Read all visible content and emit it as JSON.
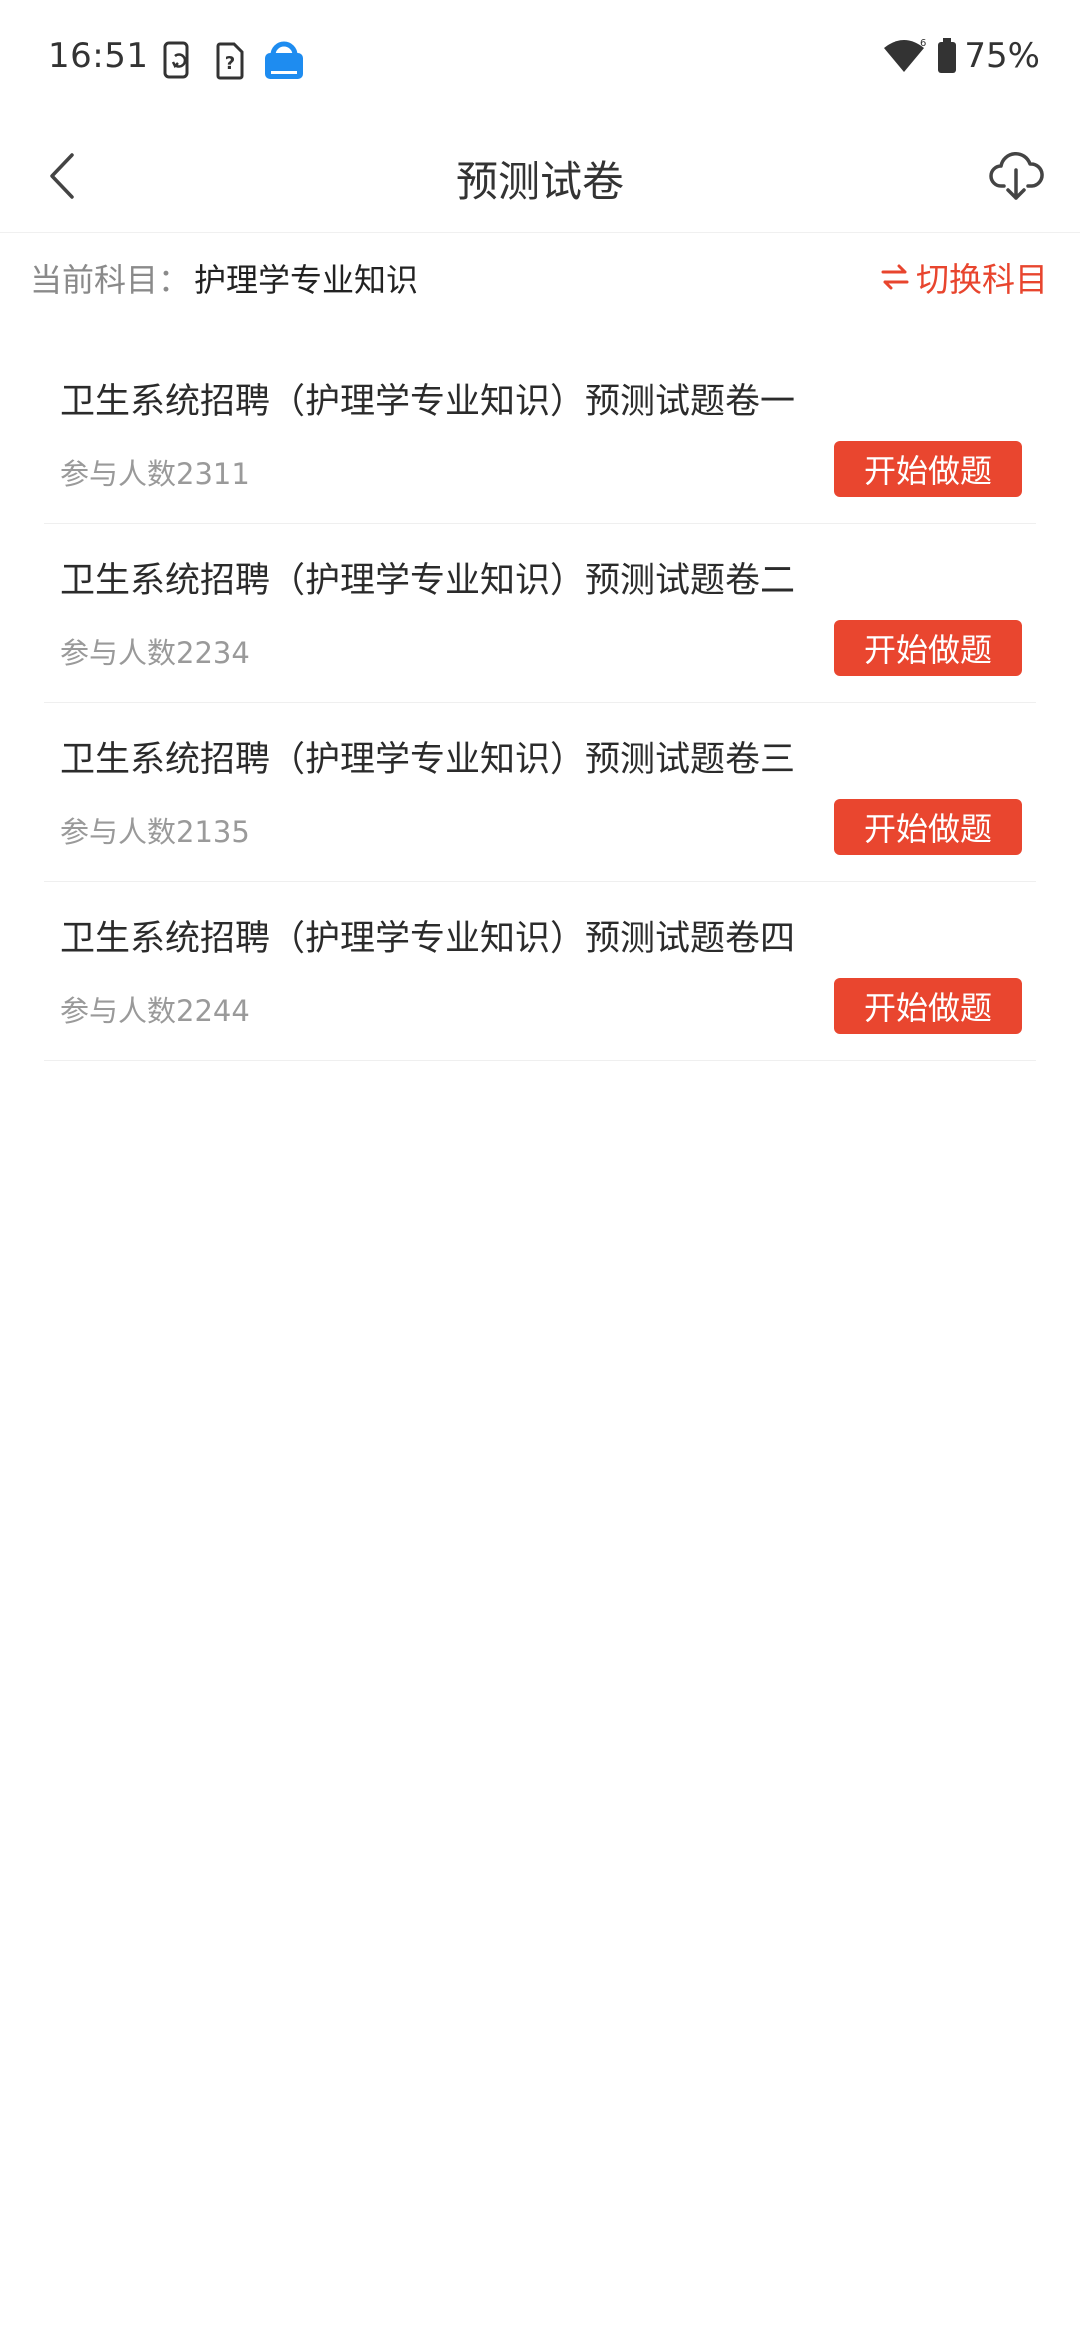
{
  "status_bar": {
    "time": "16:51",
    "icons": [
      "phone-sync-icon",
      "sim-question-icon",
      "app-notification-icon"
    ],
    "battery": "75%"
  },
  "header": {
    "title": "预测试卷",
    "back_icon": "chevron-left-icon",
    "download_icon": "cloud-download-icon"
  },
  "subject": {
    "label": "当前科目：",
    "value": "护理学专业知识",
    "switch_label": "切换科目"
  },
  "papers": [
    {
      "title": "卫生系统招聘（护理学专业知识）预测试题卷一",
      "participants": "参与人数2311",
      "button": "开始做题"
    },
    {
      "title": "卫生系统招聘（护理学专业知识）预测试题卷二",
      "participants": "参与人数2234",
      "button": "开始做题"
    },
    {
      "title": "卫生系统招聘（护理学专业知识）预测试题卷三",
      "participants": "参与人数2135",
      "button": "开始做题"
    },
    {
      "title": "卫生系统招聘（护理学专业知识）预测试题卷四",
      "participants": "参与人数2244",
      "button": "开始做题"
    }
  ],
  "colors": {
    "accent": "#e9462f",
    "text_primary": "#2b2b2b",
    "text_secondary": "#9a9a9a"
  }
}
